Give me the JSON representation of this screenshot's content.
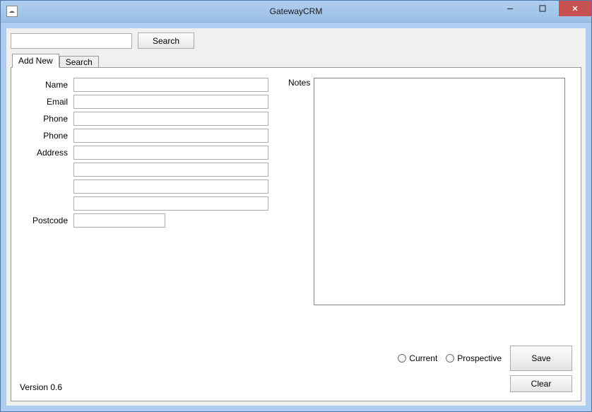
{
  "window": {
    "title": "GatewayCRM"
  },
  "toolbar": {
    "search_value": "",
    "search_button": "Search"
  },
  "tabs": {
    "add_new": "Add New",
    "search": "Search",
    "active": "add_new"
  },
  "form": {
    "labels": {
      "name": "Name",
      "email": "Email",
      "phone1": "Phone",
      "phone2": "Phone",
      "address": "Address",
      "postcode": "Postcode",
      "notes": "Notes"
    },
    "values": {
      "name": "",
      "email": "",
      "phone1": "",
      "phone2": "",
      "address1": "",
      "address2": "",
      "address3": "",
      "address4": "",
      "postcode": "",
      "notes": ""
    },
    "radios": {
      "current": "Current",
      "prospective": "Prospective"
    },
    "buttons": {
      "save": "Save",
      "clear": "Clear"
    }
  },
  "footer": {
    "version": "Version 0.6"
  }
}
